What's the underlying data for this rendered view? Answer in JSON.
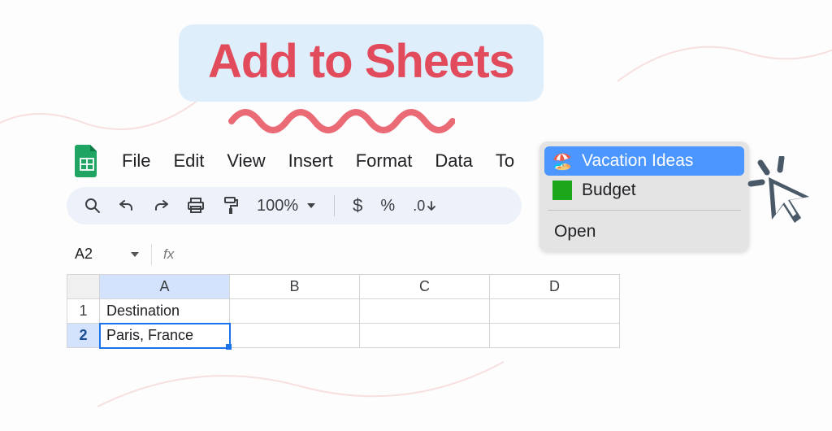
{
  "title": "Add to Sheets",
  "menu": {
    "file": "File",
    "edit": "Edit",
    "view": "View",
    "insert": "Insert",
    "format": "Format",
    "data": "Data",
    "tools": "To"
  },
  "toolbar": {
    "zoom": "100%",
    "currency": "$",
    "percent": "%",
    "decimal": ".0"
  },
  "namebox": {
    "ref": "A2",
    "fx": "fx"
  },
  "columns": [
    "A",
    "B",
    "C",
    "D"
  ],
  "rows": [
    {
      "num": "1",
      "cells": [
        "Destination",
        "",
        "",
        ""
      ]
    },
    {
      "num": "2",
      "cells": [
        "Paris, France",
        "",
        "",
        ""
      ]
    }
  ],
  "popup": {
    "item1": "Vacation Ideas",
    "item2": "Budget",
    "open": "Open"
  }
}
